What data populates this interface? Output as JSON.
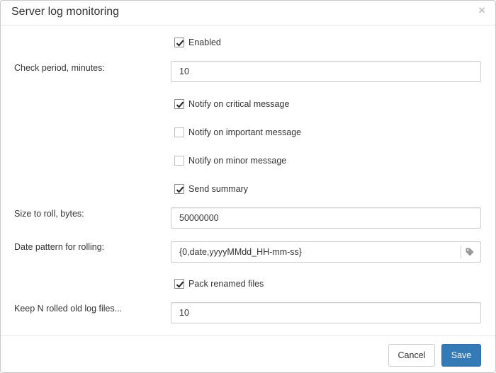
{
  "dialog": {
    "title": "Server log monitoring",
    "close_glyph": "×"
  },
  "form": {
    "enabled": {
      "label": "Enabled",
      "checked": true
    },
    "check_period": {
      "label": "Check period, minutes:",
      "value": "10"
    },
    "notify_critical": {
      "label": "Notify on critical message",
      "checked": true
    },
    "notify_important": {
      "label": "Notify on important message",
      "checked": false
    },
    "notify_minor": {
      "label": "Notify on minor message",
      "checked": false
    },
    "send_summary": {
      "label": "Send summary",
      "checked": true
    },
    "size_to_roll": {
      "label": "Size to roll, bytes:",
      "value": "50000000"
    },
    "date_pattern": {
      "label": "Date pattern for rolling:",
      "value": "{0,date,yyyyMMdd_HH-mm-ss}",
      "addon_icon": "tag-icon"
    },
    "pack_renamed": {
      "label": "Pack renamed files",
      "checked": true
    },
    "keep_n": {
      "label": "Keep N rolled old log files...",
      "value": "10"
    }
  },
  "footer": {
    "cancel_label": "Cancel",
    "save_label": "Save"
  },
  "colors": {
    "primary": "#337ab7",
    "border": "#cccccc",
    "text": "#333333"
  }
}
